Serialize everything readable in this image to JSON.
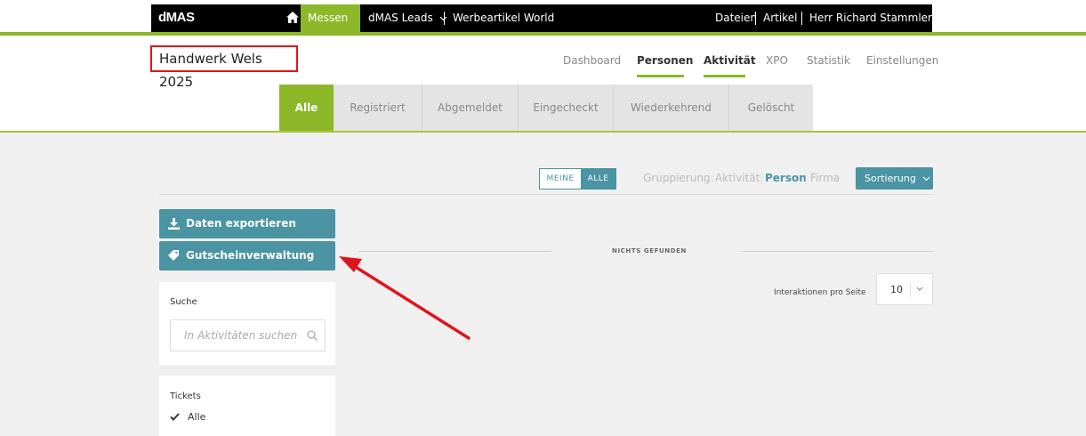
{
  "topnav": {
    "brand": "dMAS",
    "messen": "Messen",
    "leads": "dMAS Leads",
    "werbeartikel": "Werbeartikel World",
    "dateien": "Dateien",
    "artikel": "Artikel",
    "user": "Herr Richard Stammler"
  },
  "event": {
    "title": "Handwerk Wels 2025"
  },
  "subnav": {
    "items": [
      "Dashboard",
      "Personen",
      "Aktivität",
      "XPO",
      "Statistik",
      "Einstellungen"
    ],
    "active": [
      "Personen",
      "Aktivität"
    ]
  },
  "tabs": [
    "Alle",
    "Registriert",
    "Abgemeldet",
    "Eingecheckt",
    "Wiederkehrend",
    "Gelöscht"
  ],
  "toolbar": {
    "toggle_meine": "MEINE",
    "toggle_alle": "ALLE",
    "grouping_label": "Gruppierung:",
    "grouping_options": [
      "Aktivität",
      "Person",
      "Firma"
    ],
    "grouping_active": "Person",
    "sort_label": "Sortierung"
  },
  "sidebar": {
    "export_label": "Daten exportieren",
    "voucher_label": "Gutscheinverwaltung",
    "search_title": "Suche",
    "search_placeholder": "In Aktivitäten suchen",
    "tickets_title": "Tickets",
    "tickets_option": "Alle"
  },
  "results": {
    "empty_text": "NICHTS GEFUNDEN",
    "per_page_label": "Interaktionen pro Seite",
    "per_page_value": "10"
  },
  "colors": {
    "accent_green": "#8cb82a",
    "teal": "#4a94a3",
    "highlight_red": "#e0141c"
  }
}
